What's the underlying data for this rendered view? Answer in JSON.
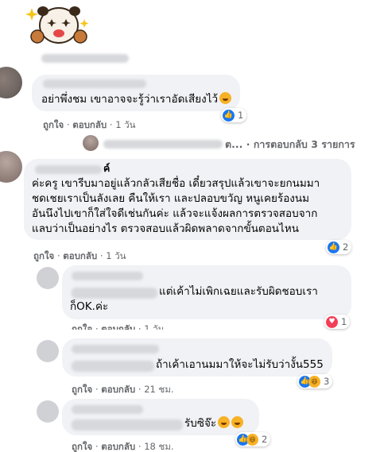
{
  "colors": {
    "bubble": "#f0f2f5",
    "meta": "#65676b",
    "like": "#1877f2",
    "love": "#f33e58",
    "haha": "#f7b125"
  },
  "comments": [
    {
      "text_lines": [
        "อย่าพึ่งชม เขาอาจจะรู้ว่าเราอัดเสียงไว้"
      ],
      "like_label": "ถูกใจ",
      "reply_label": "ตอบกลับ",
      "time": "1 วัน",
      "reaction_count": "1",
      "reaction_icons": [
        "like-icon"
      ],
      "trailing_emoji": "fearful-face-emoji"
    },
    {
      "text_lines": [
        "ค่ะครู เขารีบมาอยู่แล้วกลัวเสียชื่อ เดี๋ยวสรุปแล้วเขาจะยกนมมา",
        "ชดเชยเราเป็นลังเลย คืนให้เรา และปลอบขวัญ หนูเคยร้องนม",
        "อันนึงไปเขาก็ใส่ใจดีเช่นกันค่ะ แล้วจะแจ้งผลการตรวจสอบจาก",
        "แลบว่าเป็นอย่างไร ตรวจสอบแล้วผิดพลาดจากขั้นตอนไหน"
      ],
      "like_label": "ถูกใจ",
      "reply_label": "ตอบกลับ",
      "time": "1 วัน",
      "reaction_count": "2",
      "reaction_icons": [
        "like-icon"
      ]
    },
    {
      "text_lines": [
        "แต่เค้าไม่เพิกเฉยและรับผิดชอบเรา",
        "ก็OK.ค่ะ"
      ],
      "like_label": "ถูกใจ",
      "reply_label": "ตอบกลับ",
      "time": "1 วัน",
      "reaction_count": "1",
      "reaction_icons": [
        "love-icon"
      ]
    },
    {
      "text_lines": [
        "ถ้าเค้าเอานมมาให้จะไม่รับว่างั้น555"
      ],
      "like_label": "ถูกใจ",
      "reply_label": "ตอบกลับ",
      "time": "21 ชม.",
      "reaction_count": "3",
      "reaction_icons": [
        "like-icon",
        "haha-icon"
      ]
    },
    {
      "text_lines": [
        "รับซิจ๊ะ"
      ],
      "like_label": "ถูกใจ",
      "reply_label": "ตอบกลับ",
      "time": "18 ชม.",
      "reaction_count": "2",
      "reaction_icons": [
        "like-icon",
        "haha-icon"
      ],
      "trailing_emoji": "grinning-face-emoji"
    }
  ],
  "replies_link": {
    "prefix": "ต...",
    "label": "การตอบกลับ 3 รายการ"
  },
  "partial_name": "ค์",
  "separator": "·"
}
